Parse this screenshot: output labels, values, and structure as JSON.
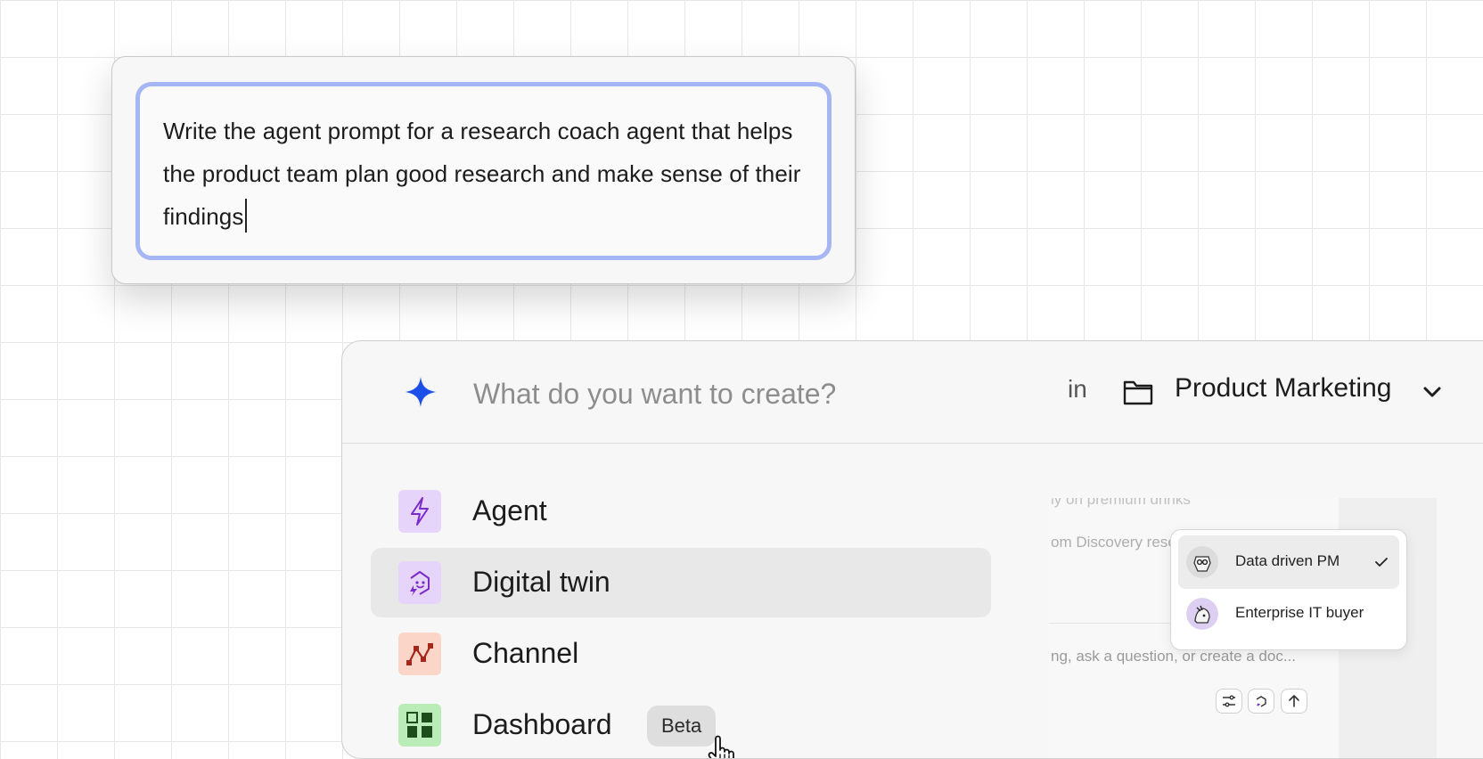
{
  "prompt": {
    "text": "Write the agent prompt for a research coach agent that helps the product team plan good research and make sense of their findings"
  },
  "create": {
    "placeholder": "What do you want to create?",
    "in_label": "in",
    "folder_name": "Product Marketing",
    "items": [
      {
        "label": "Agent",
        "icon": "lightning-icon",
        "color": "#e6d4fa"
      },
      {
        "label": "Digital twin",
        "icon": "twin-face-icon",
        "color": "#e6d4fa"
      },
      {
        "label": "Channel",
        "icon": "channel-icon",
        "color": "#fbd5c8"
      },
      {
        "label": "Dashboard",
        "icon": "dashboard-icon",
        "color": "#b9ecb6",
        "badge": "Beta"
      }
    ],
    "accent_color": "#1c4ee8"
  },
  "preview": {
    "line1": "ly on premium drinks",
    "line2": "om Discovery rese",
    "line3": "ng, ask a question, or create a doc...",
    "twins": [
      {
        "name": "Data driven PM",
        "selected": true
      },
      {
        "name": "Enterprise IT buyer",
        "selected": false
      }
    ]
  }
}
